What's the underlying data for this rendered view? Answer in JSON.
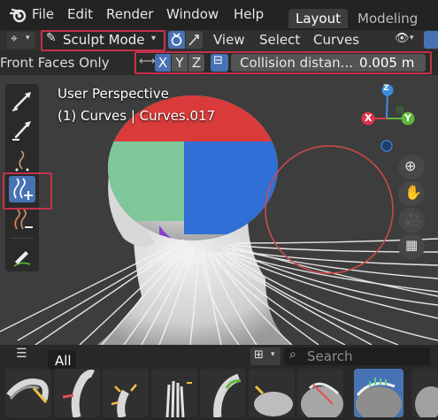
{
  "menubar": {
    "items": [
      "File",
      "Edit",
      "Render",
      "Window",
      "Help"
    ],
    "workspaces": [
      "Layout",
      "Modeling"
    ],
    "active_workspace": "Layout"
  },
  "header": {
    "mode": "Sculpt Mode",
    "menus": [
      "View",
      "Select",
      "Curves"
    ]
  },
  "tool_header": {
    "front_faces": "Front Faces Only",
    "axes": [
      "X",
      "Y",
      "Z"
    ],
    "collision_label": "Collision distan...",
    "collision_value": "0.005 m"
  },
  "viewport": {
    "perspective": "User Perspective",
    "object": "(1) Curves | Curves.017",
    "gizmo_axes": [
      "X",
      "Y",
      "Z"
    ]
  },
  "asset_shelf": {
    "catalog": "All",
    "search_placeholder": "Search",
    "brush_count": 9
  },
  "colors": {
    "accent": "#4772b3",
    "highlight_box": "#c4314a",
    "axis_x": "#e0324a",
    "axis_y": "#5fb83a",
    "axis_z": "#3d8ee0"
  }
}
